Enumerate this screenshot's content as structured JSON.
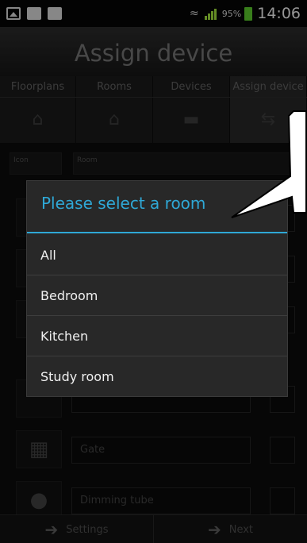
{
  "status_bar": {
    "battery_percent": "95%",
    "time": "14:06"
  },
  "header": {
    "title": "Assign device"
  },
  "tabs": [
    {
      "label": "Floorplans",
      "icon": "house-cross-icon",
      "active": false
    },
    {
      "label": "Rooms",
      "icon": "house-icon",
      "active": false
    },
    {
      "label": "Devices",
      "icon": "plug-icon",
      "active": false
    },
    {
      "label": "Assign device",
      "icon": "assign-arrows-icon",
      "active": true
    }
  ],
  "list": {
    "header": {
      "icon_label": "Icon",
      "room_label": "Room"
    },
    "visible_rows": [
      {
        "name": "Gate",
        "icon": "gate-icon"
      },
      {
        "name": "Dimming tube",
        "icon": "lightbulb-icon"
      }
    ]
  },
  "dialog": {
    "title": "Please select a room",
    "options": [
      "All",
      "Bedroom",
      "Kitchen",
      "Study room"
    ]
  },
  "bottom_bar": {
    "back_label": "Settings",
    "next_label": "Next"
  },
  "colors": {
    "accent": "#2fa8d6",
    "battery": "#57c22a"
  }
}
